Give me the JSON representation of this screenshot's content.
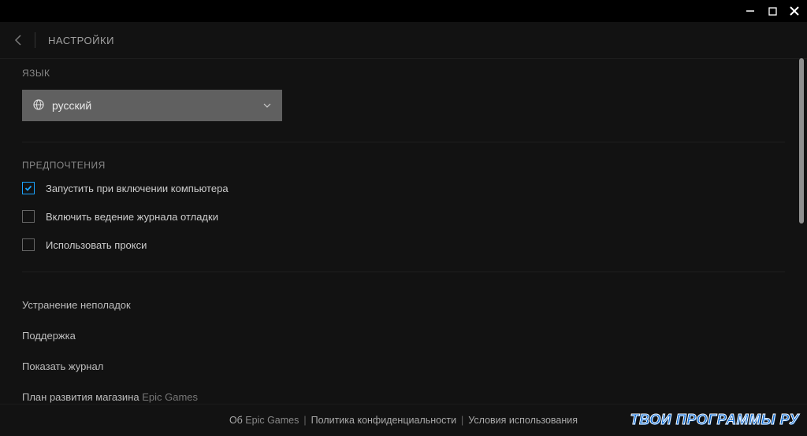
{
  "header": {
    "title": "НАСТРОЙКИ"
  },
  "language": {
    "label": "ЯЗЫК",
    "selected": "русский"
  },
  "preferences": {
    "label": "ПРЕДПОЧТЕНИЯ",
    "items": [
      {
        "label": "Запустить при включении компьютера",
        "checked": true
      },
      {
        "label": "Включить ведение журнала отладки",
        "checked": false
      },
      {
        "label": "Использовать прокси",
        "checked": false
      }
    ]
  },
  "links": {
    "troubleshoot": "Устранение неполадок",
    "support": "Поддержка",
    "showlog": "Показать журнал",
    "roadmap_pre": "План развития магазина ",
    "roadmap_brand": "Epic Games"
  },
  "footer": {
    "about_pre": "Об ",
    "about_brand": "Epic Games",
    "privacy": "Политика конфиденциальности",
    "terms": "Условия использования",
    "sep": "|"
  },
  "watermark": "ТВОИ ПРОГРАММЫ РУ"
}
